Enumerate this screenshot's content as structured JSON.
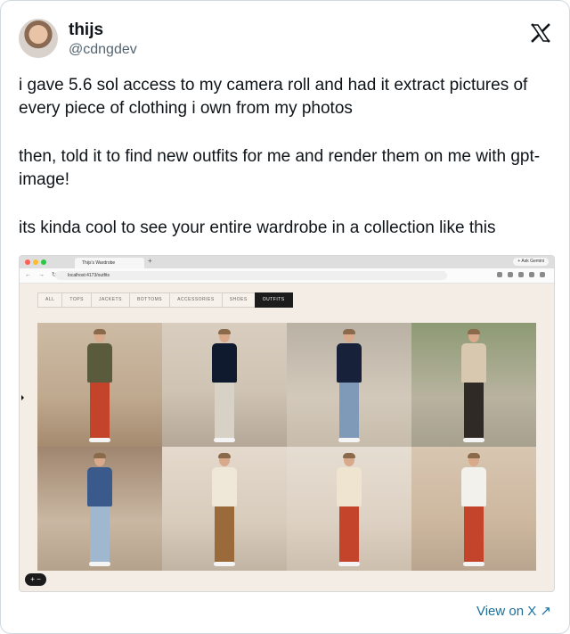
{
  "author": {
    "name": "thijs",
    "handle": "@cdngdev"
  },
  "post": {
    "paragraphs": [
      "i gave 5.6 sol access to my camera roll and had it extract pictures of every piece of clothing i own from my photos",
      "then, told it to find new outfits for me and render them on me with gpt-image!",
      "its kinda cool to see your entire wardrobe in a collection like this"
    ]
  },
  "screenshot": {
    "tab_title": "Thijs's Wardrobe",
    "new_tab_symbol": "+",
    "ask_gemini": "+ Ask Gemini",
    "url": "localhost:4173/outfits",
    "nav_glyphs": "← → ↻",
    "filters": [
      "ALL",
      "TOPS",
      "JACKETS",
      "BOTTOMS",
      "ACCESSORIES",
      "SHOES",
      "OUTFITS"
    ],
    "active_filter": "OUTFITS",
    "zoom_button": "+ −",
    "outfits": [
      {
        "top": "#5a5a3c",
        "bottom": "#c4432b",
        "bg": "bg1"
      },
      {
        "top": "#101a2e",
        "bottom": "#d8d2c6",
        "bg": "bg2"
      },
      {
        "top": "#17223a",
        "bottom": "#7f9ab9",
        "bg": "bg3"
      },
      {
        "top": "#d8c8b0",
        "bottom": "#2f2a25",
        "bg": "bg4"
      },
      {
        "top": "#3a5a8c",
        "bottom": "#9fb7cf",
        "bg": "bg5"
      },
      {
        "top": "#efe7d8",
        "bottom": "#9a6a3a",
        "bg": "bg6"
      },
      {
        "top": "#eee4cf",
        "bottom": "#c4432b",
        "bg": "bg7"
      },
      {
        "top": "#f3f1ec",
        "bottom": "#c4432b",
        "bg": "bg8"
      }
    ]
  },
  "footer": {
    "view_on_x": "View on X ↗"
  },
  "colors": {
    "link": "#1d6f9a",
    "text": "#0f1419",
    "muted": "#536471"
  }
}
